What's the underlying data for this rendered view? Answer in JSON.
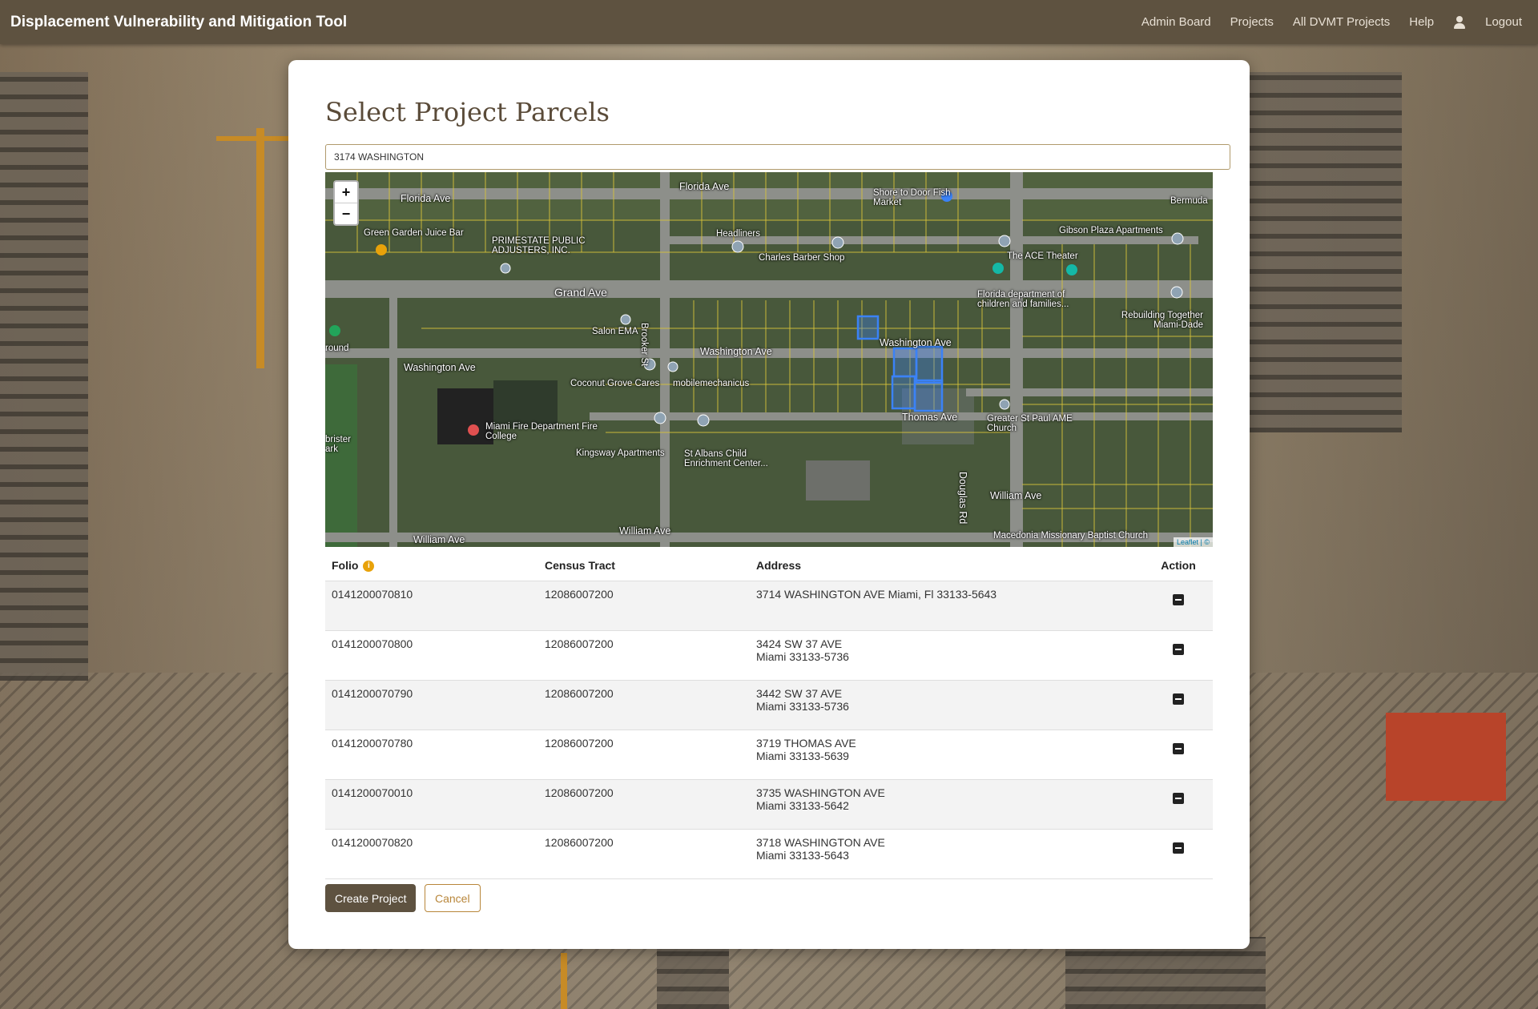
{
  "navbar": {
    "brand": "Displacement Vulnerability and Mitigation Tool",
    "links": [
      "Admin Board",
      "Projects",
      "All DVMT Projects",
      "Help"
    ],
    "logout": "Logout",
    "user_icon": "user-icon"
  },
  "page": {
    "title": "Select Project Parcels",
    "search_value": "3174 WASHINGTON"
  },
  "map": {
    "zoom_in": "+",
    "zoom_out": "−",
    "attribution": "Leaflet | ©",
    "labels": {
      "florida_ave_1": "Florida Ave",
      "florida_ave_2": "Florida Ave",
      "green_garden": "Green Garden Juice Bar",
      "primestate": "PRIMESTATE PUBLIC ADJUSTERS, INC.",
      "headliners": "Headliners",
      "charles_barber": "Charles Barber Shop",
      "shore_to_door": "Shore to Door Fish Market",
      "bermuda": "Bermuda",
      "gibson": "Gibson Plaza Apartments",
      "ace_theater": "The ACE Theater",
      "grand_ave": "Grand Ave",
      "fl_dept": "Florida department of children and families...",
      "rebuilding": "Rebuilding Together Miami-Dade",
      "salon": "Salon EMA",
      "brooker": "Brooker St",
      "washington_1": "Washington Ave",
      "washington_2": "Washington Ave",
      "washington_3": "Washington Ave",
      "ground": "round",
      "coconut": "Coconut Grove Cares",
      "mobile": "mobilemechanicus",
      "miami_fire": "Miami Fire Department Fire College",
      "thomas": "Thomas Ave",
      "st_paul": "Greater St Paul AME Church",
      "kingsway": "Kingsway Apartments",
      "st_albans": "St Albans Child Enrichment Center...",
      "brister": "brister ark",
      "douglas": "Douglas Rd",
      "william_1": "William Ave",
      "william_2": "William Ave",
      "william_3": "William Ave",
      "macedonia": "Macedonia Missionary Baptist Church"
    }
  },
  "table": {
    "headers": {
      "folio": "Folio",
      "tract": "Census Tract",
      "address": "Address",
      "action": "Action"
    },
    "rows": [
      {
        "folio": "0141200070810",
        "tract": "12086007200",
        "addr1": "3714 WASHINGTON AVE Miami, Fl 33133-5643",
        "addr2": ""
      },
      {
        "folio": "0141200070800",
        "tract": "12086007200",
        "addr1": "3424 SW 37 AVE",
        "addr2": "Miami 33133-5736"
      },
      {
        "folio": "0141200070790",
        "tract": "12086007200",
        "addr1": "3442 SW 37 AVE",
        "addr2": "Miami 33133-5736"
      },
      {
        "folio": "0141200070780",
        "tract": "12086007200",
        "addr1": "3719 THOMAS AVE",
        "addr2": "Miami 33133-5639"
      },
      {
        "folio": "0141200070010",
        "tract": "12086007200",
        "addr1": "3735 WASHINGTON AVE",
        "addr2": "Miami 33133-5642"
      },
      {
        "folio": "0141200070820",
        "tract": "12086007200",
        "addr1": "3718 WASHINGTON AVE",
        "addr2": "Miami 33133-5643"
      }
    ]
  },
  "actions": {
    "create": "Create Project",
    "cancel": "Cancel"
  },
  "colors": {
    "navbar": "#5e5240",
    "accent": "#b8863a",
    "parcel_highlight": "#3b82f6",
    "parcel_outline": "#d8c23a"
  }
}
